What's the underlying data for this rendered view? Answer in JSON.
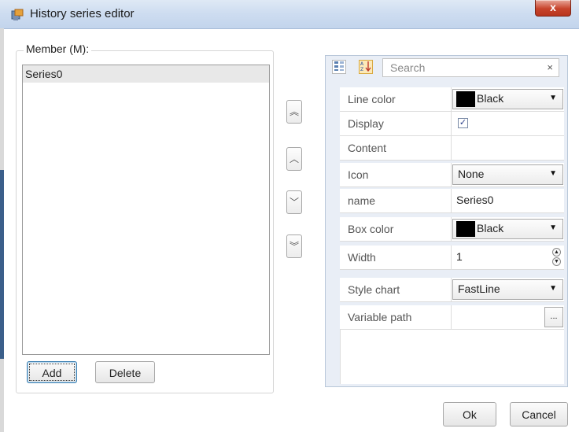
{
  "window": {
    "title": "History series editor",
    "close_label": "x"
  },
  "member": {
    "group_label": "Member (M):",
    "items": [
      "Series0"
    ],
    "add_label": "Add",
    "delete_label": "Delete"
  },
  "order_buttons": {
    "top": "︽",
    "up": "︿",
    "down": "﹀",
    "bottom": "︾"
  },
  "property_grid": {
    "categorized_icon": "categorized-icon",
    "sort_icon": "alphabetical-sort-icon",
    "search_placeholder": "Search",
    "search_clear": "×",
    "rows": [
      {
        "label": "Line color",
        "value": "Black",
        "color": "#000000"
      },
      {
        "label": "Display",
        "checked": true,
        "check_mark": "✓"
      },
      {
        "label": "Content",
        "value": ""
      },
      {
        "label": "Icon",
        "value": "None"
      },
      {
        "label": "name",
        "value": "Series0"
      },
      {
        "label": "Box color",
        "value": "Black",
        "color": "#000000"
      },
      {
        "label": "Width",
        "value": "1"
      },
      {
        "label": "Style chart",
        "value": "FastLine"
      },
      {
        "label": "Variable path",
        "value": "",
        "button": "..."
      }
    ]
  },
  "dialog": {
    "ok_label": "Ok",
    "cancel_label": "Cancel"
  },
  "colors": {
    "titlebar": "#cddcf0",
    "close_button": "#c7442c",
    "selection": "#e8e8e8",
    "grid_background": "#e9eef6"
  }
}
